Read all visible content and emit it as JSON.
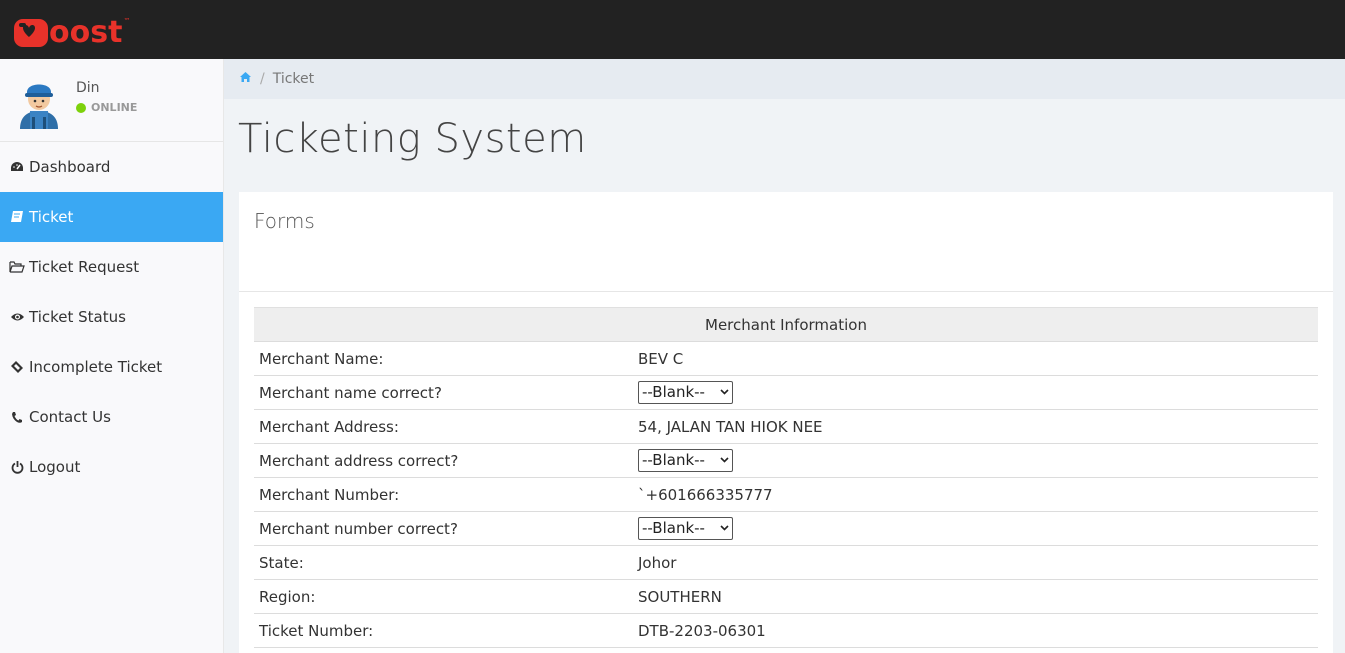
{
  "brand": {
    "name": "oost",
    "tm": "™",
    "color": "#e8322a"
  },
  "user": {
    "name": "Din",
    "status": "ONLINE"
  },
  "nav": [
    {
      "label": "Dashboard",
      "icon": "dashboard-icon",
      "active": false
    },
    {
      "label": "Ticket",
      "icon": "book-icon",
      "active": true
    },
    {
      "label": "Ticket Request",
      "icon": "folder-open-icon",
      "active": false
    },
    {
      "label": "Ticket Status",
      "icon": "eye-icon",
      "active": false
    },
    {
      "label": "Incomplete Ticket",
      "icon": "ticket-icon",
      "active": false
    },
    {
      "label": "Contact Us",
      "icon": "phone-icon",
      "active": false
    },
    {
      "label": "Logout",
      "icon": "power-icon",
      "active": false
    }
  ],
  "breadcrumb": {
    "home_icon": "home-icon",
    "current": "Ticket"
  },
  "page": {
    "title": "Ticketing System"
  },
  "panel": {
    "title": "Forms"
  },
  "table": {
    "header": "Merchant Information",
    "rows": [
      {
        "label": "Merchant Name:",
        "value": "BEV C"
      },
      {
        "label": "Merchant name correct?",
        "select": "--Blank--"
      },
      {
        "label": "Merchant Address:",
        "value": "54, JALAN TAN HIOK NEE"
      },
      {
        "label": "Merchant address correct?",
        "select": "--Blank--"
      },
      {
        "label": "Merchant Number:",
        "value": "`+601666335777"
      },
      {
        "label": "Merchant number correct?",
        "select": "--Blank--"
      },
      {
        "label": "State:",
        "value": "Johor"
      },
      {
        "label": "Region:",
        "value": "SOUTHERN"
      },
      {
        "label": "Ticket Number:",
        "value": "DTB-2203-06301"
      }
    ]
  },
  "colors": {
    "active_nav": "#3aa8f3",
    "topbar": "#222222",
    "online": "#7dd10b"
  }
}
